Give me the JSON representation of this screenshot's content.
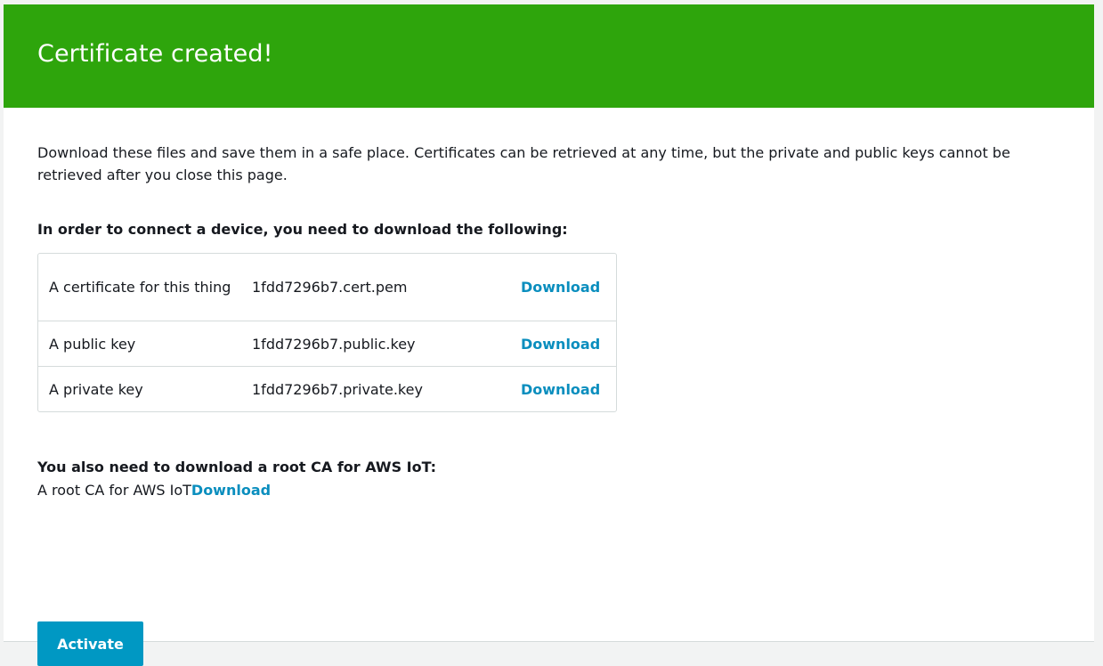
{
  "banner": {
    "title": "Certificate created!"
  },
  "intro": {
    "text": "Download these files and save them in a safe place. Certificates can be retrieved at any time, but the private and public keys cannot be retrieved after you close this page."
  },
  "device_section": {
    "heading": "In order to connect a device, you need to download the following:",
    "rows": [
      {
        "description": "A certificate for this thing",
        "filename": "1fdd7296b7.cert.pem",
        "action": "Download"
      },
      {
        "description": "A public key",
        "filename": "1fdd7296b7.public.key",
        "action": "Download"
      },
      {
        "description": "A private key",
        "filename": "1fdd7296b7.private.key",
        "action": "Download"
      }
    ]
  },
  "root_ca": {
    "heading": "You also need to download a root CA for AWS IoT:",
    "label": "A root CA for AWS IoT",
    "action": "Download"
  },
  "actions": {
    "activate_label": "Activate"
  },
  "colors": {
    "banner_green": "#2ea50c",
    "link_blue": "#0a8ebe",
    "button_blue": "#0098c3"
  }
}
